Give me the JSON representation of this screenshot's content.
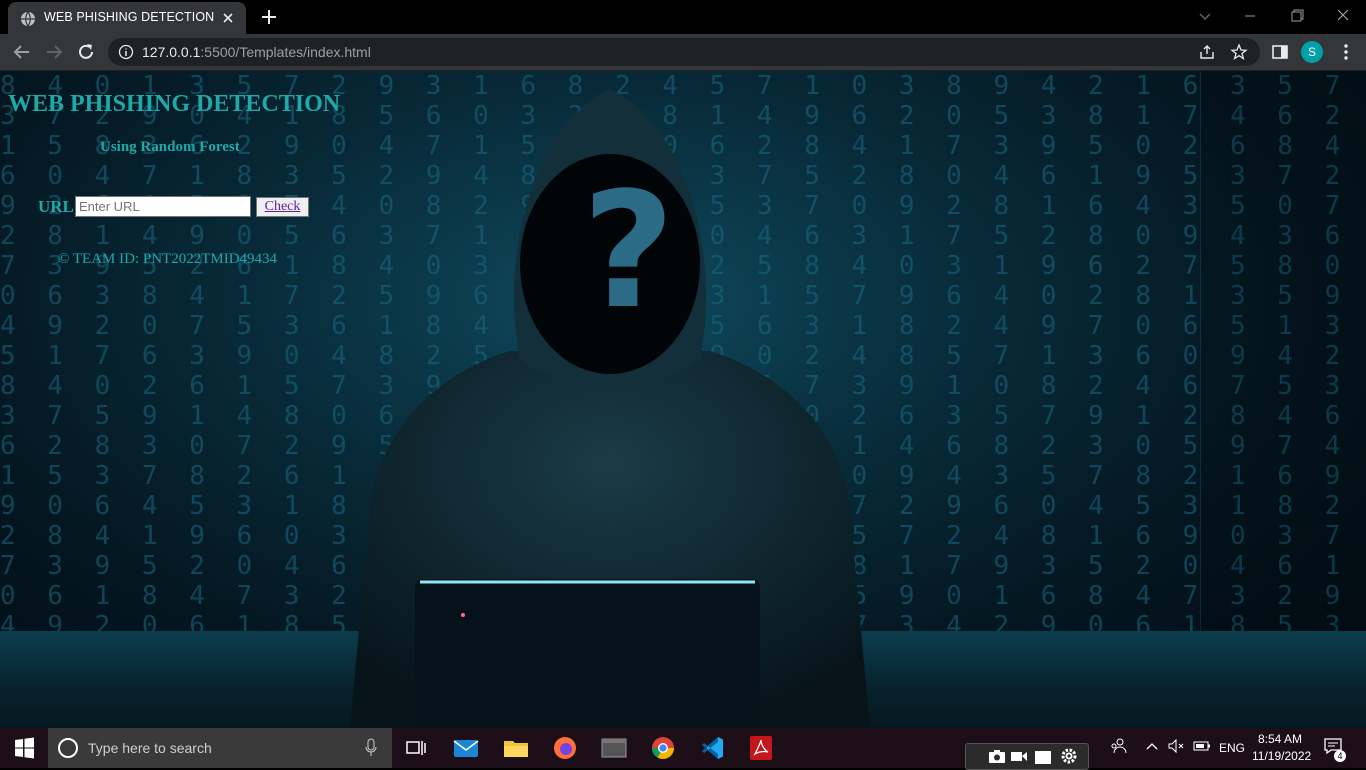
{
  "browser": {
    "tab_title": "WEB PHISHING DETECTION",
    "url_host": "127.0.0.1",
    "url_rest": ":5500/Templates/index.html",
    "profile_initial": "S"
  },
  "page": {
    "title": "WEB PHISHING DETECTION",
    "subtitle": "Using Random Forest",
    "url_label": "URL",
    "url_placeholder": "Enter URL",
    "check_label": "Check",
    "team": "© TEAM ID: PNT2022TMID49434",
    "background_glyph": "?"
  },
  "taskbar": {
    "search_placeholder": "Type here to search",
    "language": "ENG",
    "time": "8:54 AM",
    "date": "11/19/2022",
    "notification_count": "4",
    "apps": [
      "task-view-icon",
      "mail-icon",
      "file-explorer-icon",
      "firefox-icon",
      "terminal-icon",
      "chrome-icon",
      "vscode-icon",
      "acrobat-icon"
    ]
  },
  "colors": {
    "accent": "#1fa9a9",
    "chrome_dark": "#35363a"
  }
}
